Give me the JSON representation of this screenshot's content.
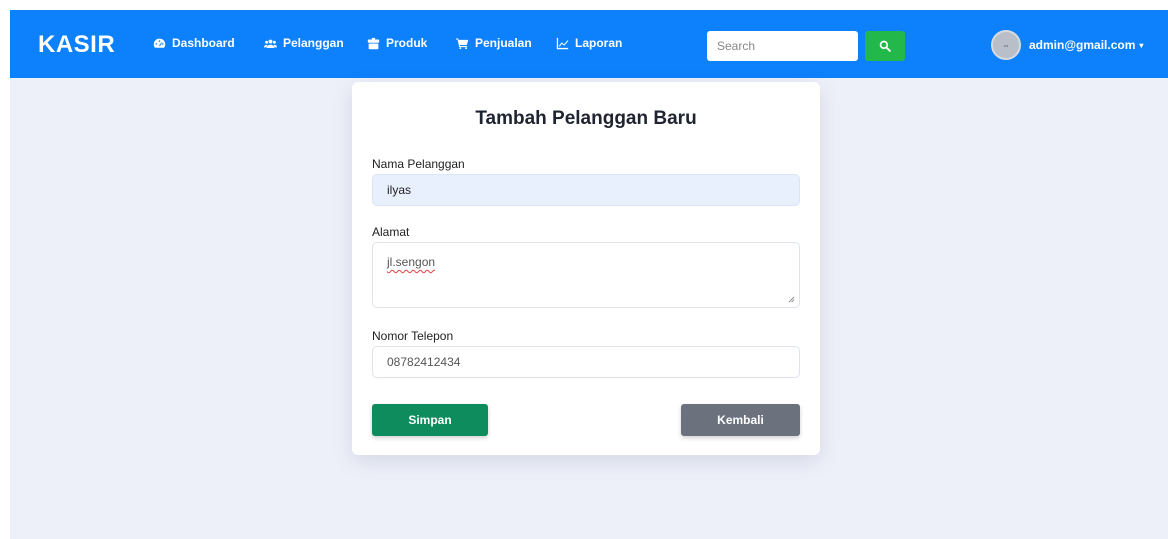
{
  "navbar": {
    "brand": "KASIR",
    "items": [
      {
        "label": "Dashboard",
        "icon": "tachometer-icon"
      },
      {
        "label": "Pelanggan",
        "icon": "users-icon"
      },
      {
        "label": "Produk",
        "icon": "box-icon"
      },
      {
        "label": "Penjualan",
        "icon": "cart-icon"
      },
      {
        "label": "Laporan",
        "icon": "chart-line-icon"
      }
    ],
    "search_placeholder": "Search",
    "user_email": "admin@gmail.com",
    "color": "#0d80fc",
    "search_button_color": "#23b84a"
  },
  "form": {
    "title": "Tambah Pelanggan Baru",
    "name_label": "Nama Pelanggan",
    "name_value": "ilyas",
    "address_label": "Alamat",
    "address_value": "jl.sengon",
    "phone_label": "Nomor Telepon",
    "phone_value": "08782412434",
    "save_label": "Simpan",
    "back_label": "Kembali",
    "save_color": "#0e8c5d",
    "back_color": "#6b727d"
  }
}
